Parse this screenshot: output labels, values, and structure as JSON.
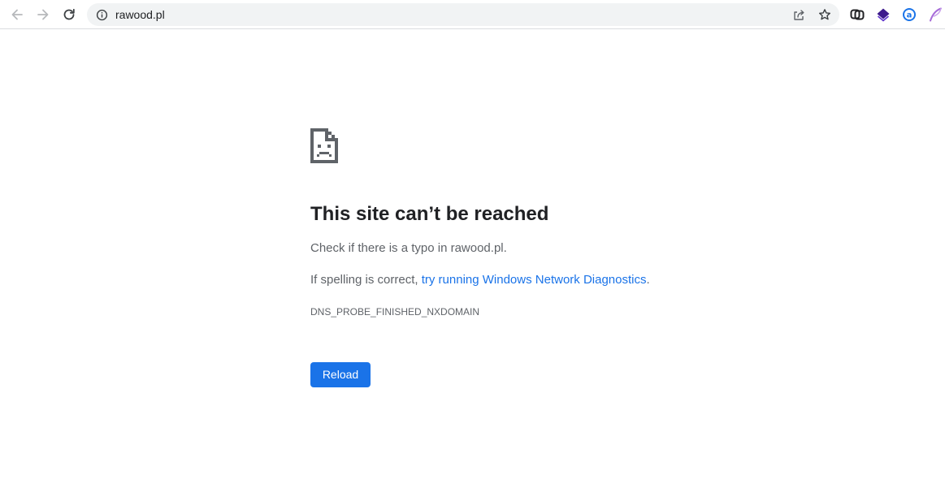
{
  "browser": {
    "url": "rawood.pl",
    "nav": {
      "back_icon": "arrow-left-icon",
      "forward_icon": "arrow-right-icon",
      "reload_icon": "reload-icon"
    },
    "omnibox": {
      "site_info_icon": "info-icon",
      "share_icon": "share-icon",
      "bookmark_icon": "star-icon"
    },
    "extensions": [
      {
        "name": "extension-link-icon",
        "color": "#202124"
      },
      {
        "name": "extension-stack-icon",
        "color": "#3d1a8c"
      },
      {
        "name": "extension-a-icon",
        "color": "#1a73e8"
      },
      {
        "name": "extension-feather-icon",
        "color": "#a66bd8"
      }
    ]
  },
  "error_page": {
    "icon": "sad-page-icon",
    "heading": "This site can’t be reached",
    "check_text": "Check if there is a typo in rawood.pl.",
    "spelling_prefix": "If spelling is correct, ",
    "diagnostics_link": "try running Windows Network Diagnostics",
    "spelling_suffix": ".",
    "error_code": "DNS_PROBE_FINISHED_NXDOMAIN",
    "reload_label": "Reload"
  },
  "colors": {
    "accent": "#1a73e8",
    "heading": "#202124",
    "body_text": "#5f6368"
  }
}
